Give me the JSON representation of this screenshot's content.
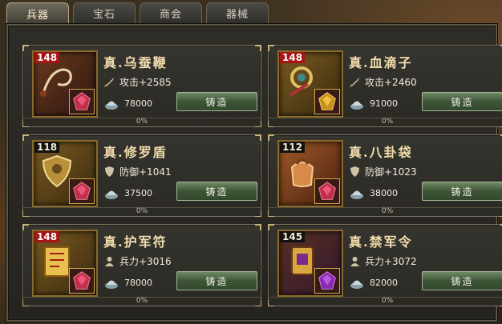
{
  "tabs": [
    {
      "label": "兵器",
      "active": true
    },
    {
      "label": "宝石",
      "active": false
    },
    {
      "label": "商会",
      "active": false
    },
    {
      "label": "器械",
      "active": false
    }
  ],
  "items": [
    {
      "level": "148",
      "level_red": true,
      "name": "真.乌蚕鞭",
      "stat": "攻击+2585",
      "stat_icon": "sword-icon",
      "cost": "78000",
      "button": "铸造",
      "progress": "0%",
      "progress_value": 0,
      "art": "whip-icon"
    },
    {
      "level": "148",
      "level_red": true,
      "name": "真.血滴子",
      "stat": "攻击+2460",
      "stat_icon": "sword-icon",
      "cost": "91000",
      "button": "铸造",
      "progress": "0%",
      "progress_value": 0,
      "art": "blood-drop-weapon-icon"
    },
    {
      "level": "118",
      "level_red": false,
      "name": "真.修罗盾",
      "stat": "防御+1041",
      "stat_icon": "shield-icon",
      "cost": "37500",
      "button": "铸造",
      "progress": "0%",
      "progress_value": 0,
      "art": "shield-art-icon"
    },
    {
      "level": "112",
      "level_red": false,
      "name": "真.八卦袋",
      "stat": "防御+1023",
      "stat_icon": "shield-icon",
      "cost": "38000",
      "button": "铸造",
      "progress": "0%",
      "progress_value": 0,
      "art": "bagua-bag-icon"
    },
    {
      "level": "148",
      "level_red": true,
      "name": "真.护军符",
      "stat": "兵力+3016",
      "stat_icon": "soldier-icon",
      "cost": "78000",
      "button": "铸造",
      "progress": "0%",
      "progress_value": 0,
      "art": "talisman-scroll-icon"
    },
    {
      "level": "145",
      "level_red": false,
      "name": "真.禁军令",
      "stat": "兵力+3072",
      "stat_icon": "soldier-icon",
      "cost": "82000",
      "button": "铸造",
      "progress": "0%",
      "progress_value": 0,
      "art": "command-token-icon"
    }
  ],
  "colors": {
    "name": "#f2ddae",
    "forge_button": "#3e5437",
    "level_red": "#a81414"
  }
}
